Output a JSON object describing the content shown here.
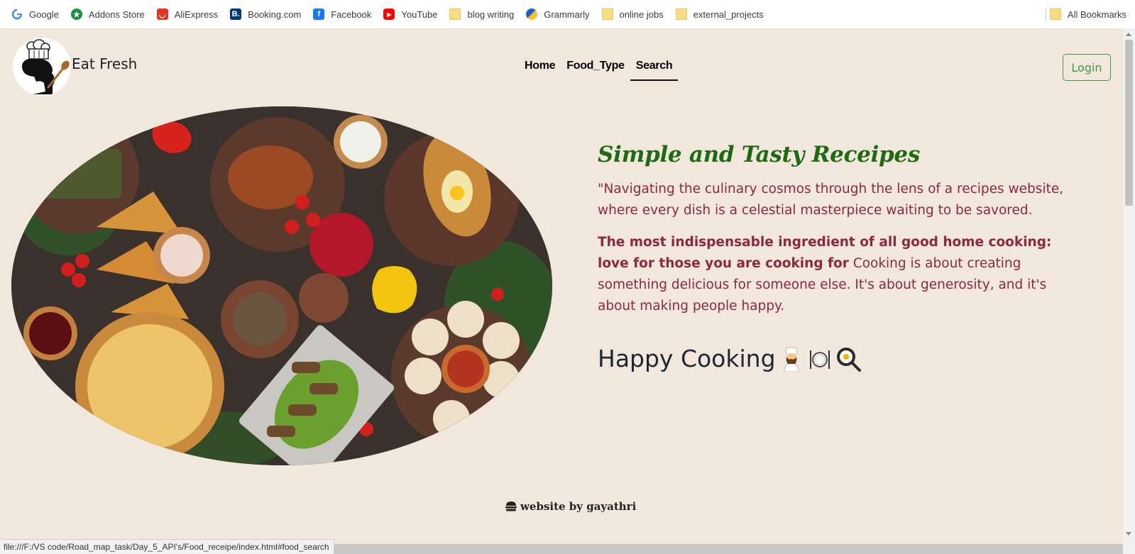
{
  "bookmarks": [
    {
      "label": "Google",
      "icon": "google-icon",
      "color": "#4285f4"
    },
    {
      "label": "Addons Store",
      "icon": "addons-store-icon",
      "color": "#1e8e3e"
    },
    {
      "label": "AliExpress",
      "icon": "aliexpress-icon",
      "color": "#e43225"
    },
    {
      "label": "Booking.com",
      "icon": "booking-icon",
      "color": "#003580"
    },
    {
      "label": "Facebook",
      "icon": "facebook-icon",
      "color": "#1877f2"
    },
    {
      "label": "YouTube",
      "icon": "youtube-icon",
      "color": "#ff0000"
    },
    {
      "label": "blog writing",
      "icon": "folder-icon"
    },
    {
      "label": "Grammarly",
      "icon": "grammarly-icon",
      "color": "#15c39a"
    },
    {
      "label": "online jobs",
      "icon": "folder-icon"
    },
    {
      "label": "external_projects",
      "icon": "folder-icon"
    }
  ],
  "all_bookmarks": "All Bookmarks",
  "header": {
    "brand": "Eat Fresh",
    "nav": [
      "Home",
      "Food_Type",
      "Search"
    ],
    "active_nav": "Search",
    "login": "Login"
  },
  "hero": {
    "tagline": "Simple and Tasty Receipes",
    "quote": "\"Navigating the culinary cosmos through the lens of a recipes website, where every dish is a celestial masterpiece waiting to be savored.",
    "bold_text": "The most indispensable ingredient of all good home cooking: love for those you are cooking for",
    "body_text": " Cooking is about creating something delicious for someone else. It's about generosity, and it's about making people happy.",
    "happy": "Happy Cooking"
  },
  "footer": {
    "text": "website by gayathri"
  },
  "status_url": "file:///F:/VS code/Road_map_task/Day_5_API's/Food_receipe/index.html#food_search",
  "colors": {
    "background": "#f1e7dc",
    "tagline": "#1f6b14",
    "text": "#8c2a3a",
    "login": "#3f9a47"
  }
}
